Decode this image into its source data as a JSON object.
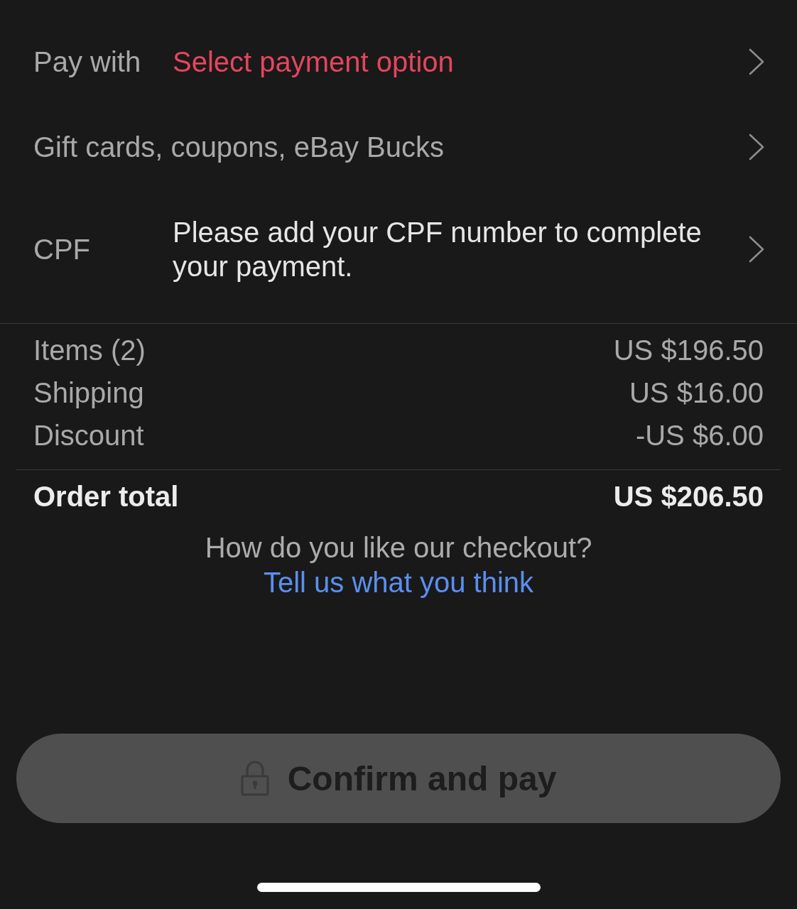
{
  "payment_rows": [
    {
      "kind": "prompt",
      "label": "Pay with",
      "value": "Select payment option"
    },
    {
      "kind": "entry",
      "label": "Gift cards, coupons, eBay Bucks"
    },
    {
      "kind": "note",
      "label": "CPF",
      "value": "Please add your CPF number to complete your payment."
    }
  ],
  "summary": {
    "lines": [
      {
        "label": "Items (2)",
        "amount": "US $196.50"
      },
      {
        "label": "Shipping",
        "amount": "US $16.00"
      },
      {
        "label": "Discount",
        "amount": "-US $6.00"
      }
    ],
    "total": {
      "label": "Order total",
      "amount": "US $206.50"
    }
  },
  "feedback": {
    "question": "How do you like our checkout?",
    "link": "Tell us what you think"
  },
  "confirm_button": {
    "label": "Confirm and pay",
    "disabled": true
  }
}
